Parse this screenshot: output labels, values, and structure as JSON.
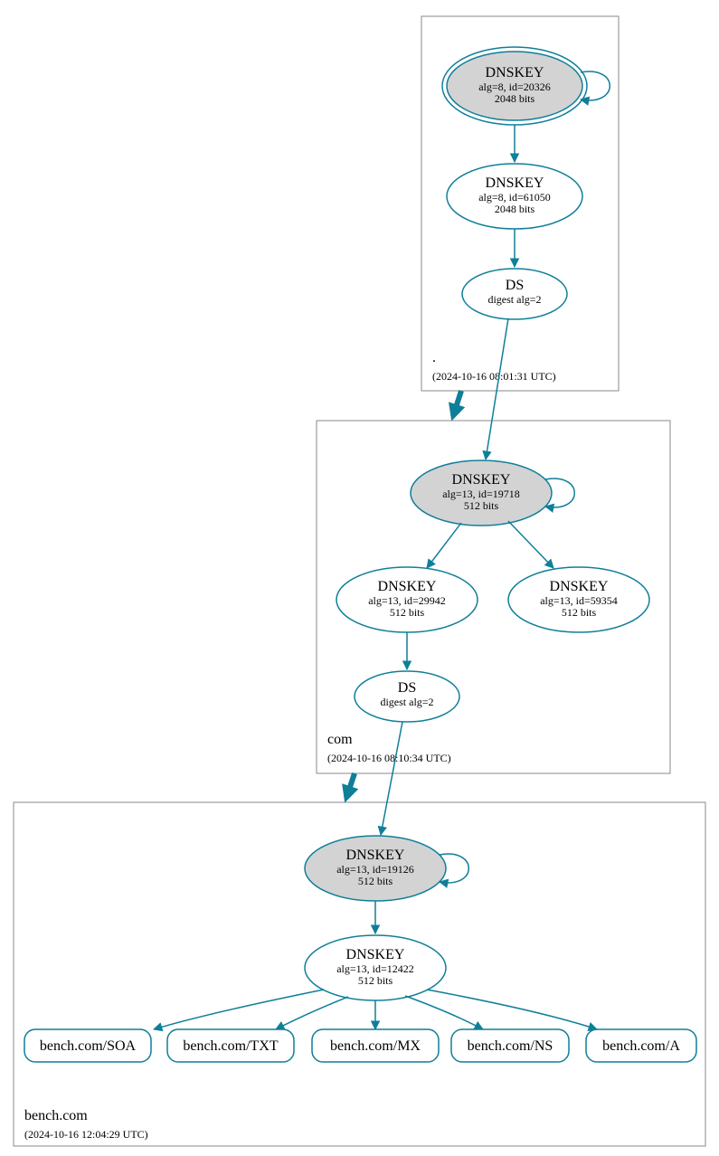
{
  "colors": {
    "stroke": "#0f7f99",
    "sep_fill": "#d3d3d3",
    "zone_border": "#888888"
  },
  "zones": {
    "root": {
      "name": ".",
      "timestamp": "(2024-10-16 08:01:31 UTC)"
    },
    "com": {
      "name": "com",
      "timestamp": "(2024-10-16 08:10:34 UTC)"
    },
    "bench": {
      "name": "bench.com",
      "timestamp": "(2024-10-16 12:04:29 UTC)"
    }
  },
  "nodes": {
    "root_ksk": {
      "title": "DNSKEY",
      "line1": "alg=8, id=20326",
      "line2": "2048 bits"
    },
    "root_zsk": {
      "title": "DNSKEY",
      "line1": "alg=8, id=61050",
      "line2": "2048 bits"
    },
    "root_ds": {
      "title": "DS",
      "line1": "digest alg=2",
      "line2": ""
    },
    "com_ksk": {
      "title": "DNSKEY",
      "line1": "alg=13, id=19718",
      "line2": "512 bits"
    },
    "com_zsk": {
      "title": "DNSKEY",
      "line1": "alg=13, id=29942",
      "line2": "512 bits"
    },
    "com_extra": {
      "title": "DNSKEY",
      "line1": "alg=13, id=59354",
      "line2": "512 bits"
    },
    "com_ds": {
      "title": "DS",
      "line1": "digest alg=2",
      "line2": ""
    },
    "bench_ksk": {
      "title": "DNSKEY",
      "line1": "alg=13, id=19126",
      "line2": "512 bits"
    },
    "bench_zsk": {
      "title": "DNSKEY",
      "line1": "alg=13, id=12422",
      "line2": "512 bits"
    }
  },
  "records": {
    "soa": "bench.com/SOA",
    "txt": "bench.com/TXT",
    "mx": "bench.com/MX",
    "ns": "bench.com/NS",
    "a": "bench.com/A"
  }
}
